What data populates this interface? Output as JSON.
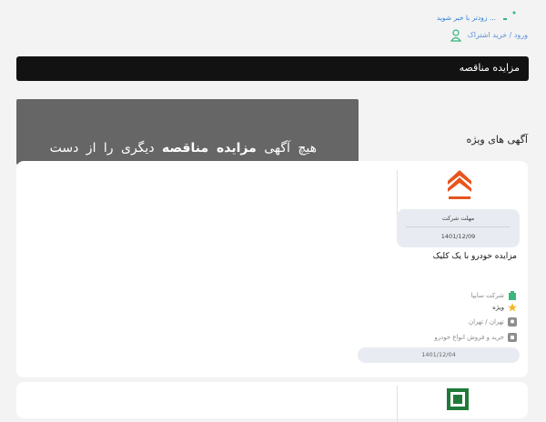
{
  "header": {
    "notify_text": "زودتر با خبر شوید ...",
    "auth_link": "ورود / خرید اشتراک",
    "accent": "#2fb67c"
  },
  "bar": {
    "title": "مزایده مناقصه"
  },
  "overlay": {
    "text_start": "هیچ  آگهی",
    "text_bold": "مزایده  مناقصه",
    "text_end": "دیگری  را  از  دست"
  },
  "featured": {
    "title": "آگهی های ویژه"
  },
  "cards": [
    {
      "logo_icon": "saipa-logo",
      "deadline_label": "مهلت شرکت",
      "deadline_date": "1401/12/09",
      "title": "مزایده خودرو با یک کلیک",
      "company": "شرکت سایپا",
      "badge": "ویژه",
      "location": "تهران / تهران",
      "category": "خرید و فروش انواع خودرو",
      "date": "1401/12/04"
    },
    {
      "logo_icon": "bank-logo"
    }
  ]
}
